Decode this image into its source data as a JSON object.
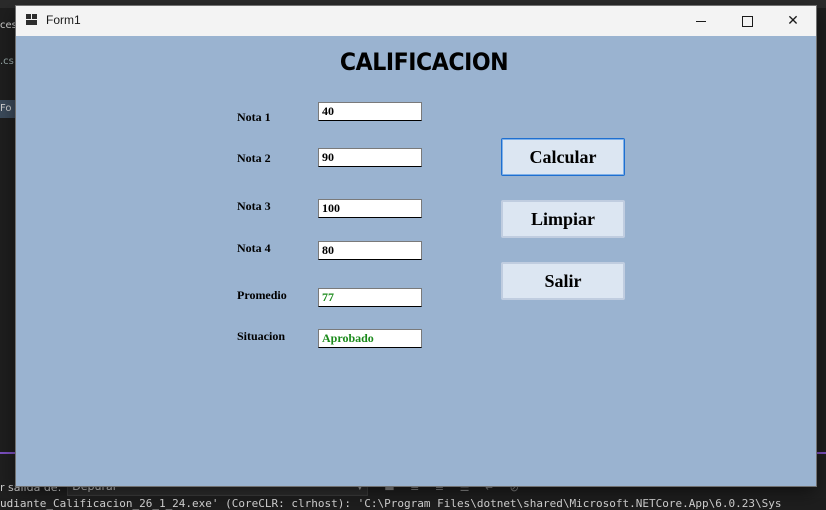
{
  "ide": {
    "left_fragments": [
      "ces",
      ".cs",
      "Fo"
    ],
    "output_label": "r salida de:",
    "output_source": "Depurar",
    "output_line": "udiante_Calificacion_26_1_24.exe' (CoreCLR: clrhost): 'C:\\Program Files\\dotnet\\shared\\Microsoft.NETCore.App\\6.0.23\\Sys"
  },
  "window": {
    "title": "Form1",
    "close_glyph": "✕"
  },
  "form": {
    "heading": "CALIFICACION",
    "fields": [
      {
        "label": "Nota 1",
        "value": "40"
      },
      {
        "label": "Nota 2",
        "value": "90"
      },
      {
        "label": "Nota 3",
        "value": "100"
      },
      {
        "label": "Nota 4",
        "value": "80"
      },
      {
        "label": "Promedio",
        "value": "77"
      },
      {
        "label": "Situacion",
        "value": "Aprobado"
      }
    ],
    "buttons": {
      "calcular": "Calcular",
      "limpiar": "Limpiar",
      "salir": "Salir"
    }
  },
  "colors": {
    "form_background": "#9ab3d0",
    "result_text": "#1a8a1a",
    "focus_border": "#1e6fd0"
  }
}
